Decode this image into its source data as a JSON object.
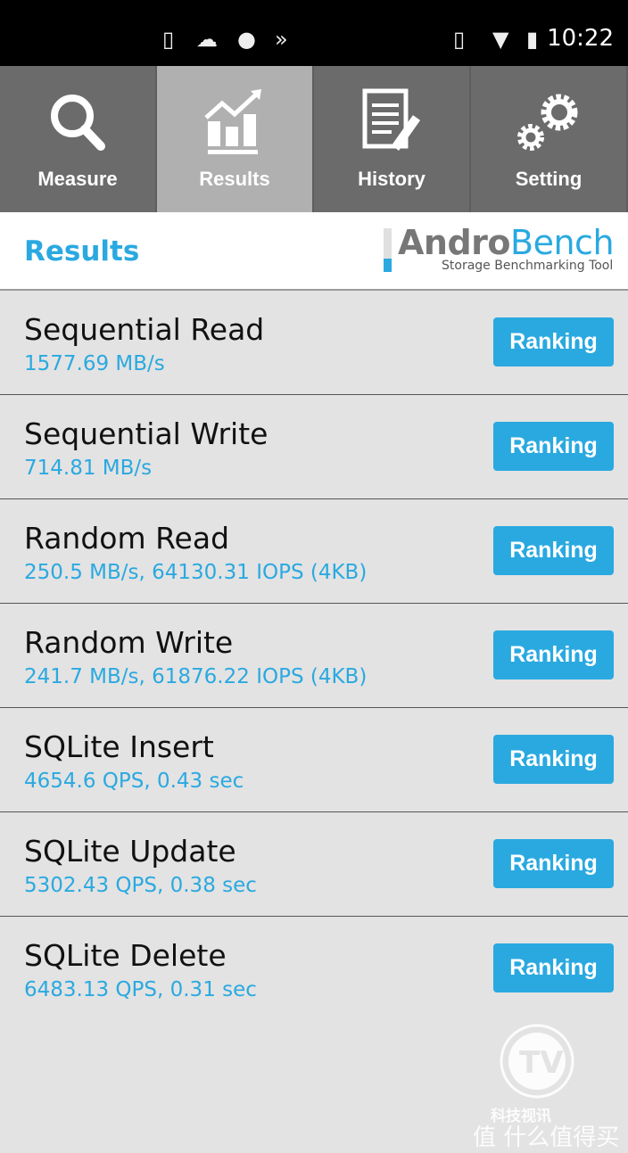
{
  "status_bar": {
    "time": "10:22",
    "icons": [
      "sim-missing-icon",
      "cloud-icon",
      "flame-icon",
      "fast-forward-icon",
      "vibrate-icon",
      "wifi-icon",
      "battery-icon"
    ]
  },
  "tabs": [
    {
      "label": "Measure",
      "icon": "search-icon"
    },
    {
      "label": "Results",
      "icon": "chart-icon",
      "active": true
    },
    {
      "label": "History",
      "icon": "document-icon"
    },
    {
      "label": "Setting",
      "icon": "gear-icon"
    }
  ],
  "header": {
    "title": "Results",
    "logo_part1": "Andro",
    "logo_part2": "Bench",
    "logo_subtitle": "Storage Benchmarking Tool"
  },
  "results": [
    {
      "name": "Sequential Read",
      "value": "1577.69 MB/s",
      "button": "Ranking"
    },
    {
      "name": "Sequential Write",
      "value": "714.81 MB/s",
      "button": "Ranking"
    },
    {
      "name": "Random Read",
      "value": "250.5 MB/s, 64130.31 IOPS (4KB)",
      "button": "Ranking"
    },
    {
      "name": "Random Write",
      "value": "241.7 MB/s, 61876.22 IOPS (4KB)",
      "button": "Ranking"
    },
    {
      "name": "SQLite Insert",
      "value": "4654.6 QPS, 0.43 sec",
      "button": "Ranking"
    },
    {
      "name": "SQLite Update",
      "value": "5302.43 QPS, 0.38 sec",
      "button": "Ranking"
    },
    {
      "name": "SQLite Delete",
      "value": "6483.13 QPS, 0.31 sec",
      "button": "Ranking"
    }
  ],
  "watermark": {
    "line1": "科技视讯",
    "line2": "值 什么值得买"
  },
  "colors": {
    "accent": "#2aa9e0",
    "tab_bg": "#6b6b6b",
    "tab_active": "#b0b0b0"
  }
}
